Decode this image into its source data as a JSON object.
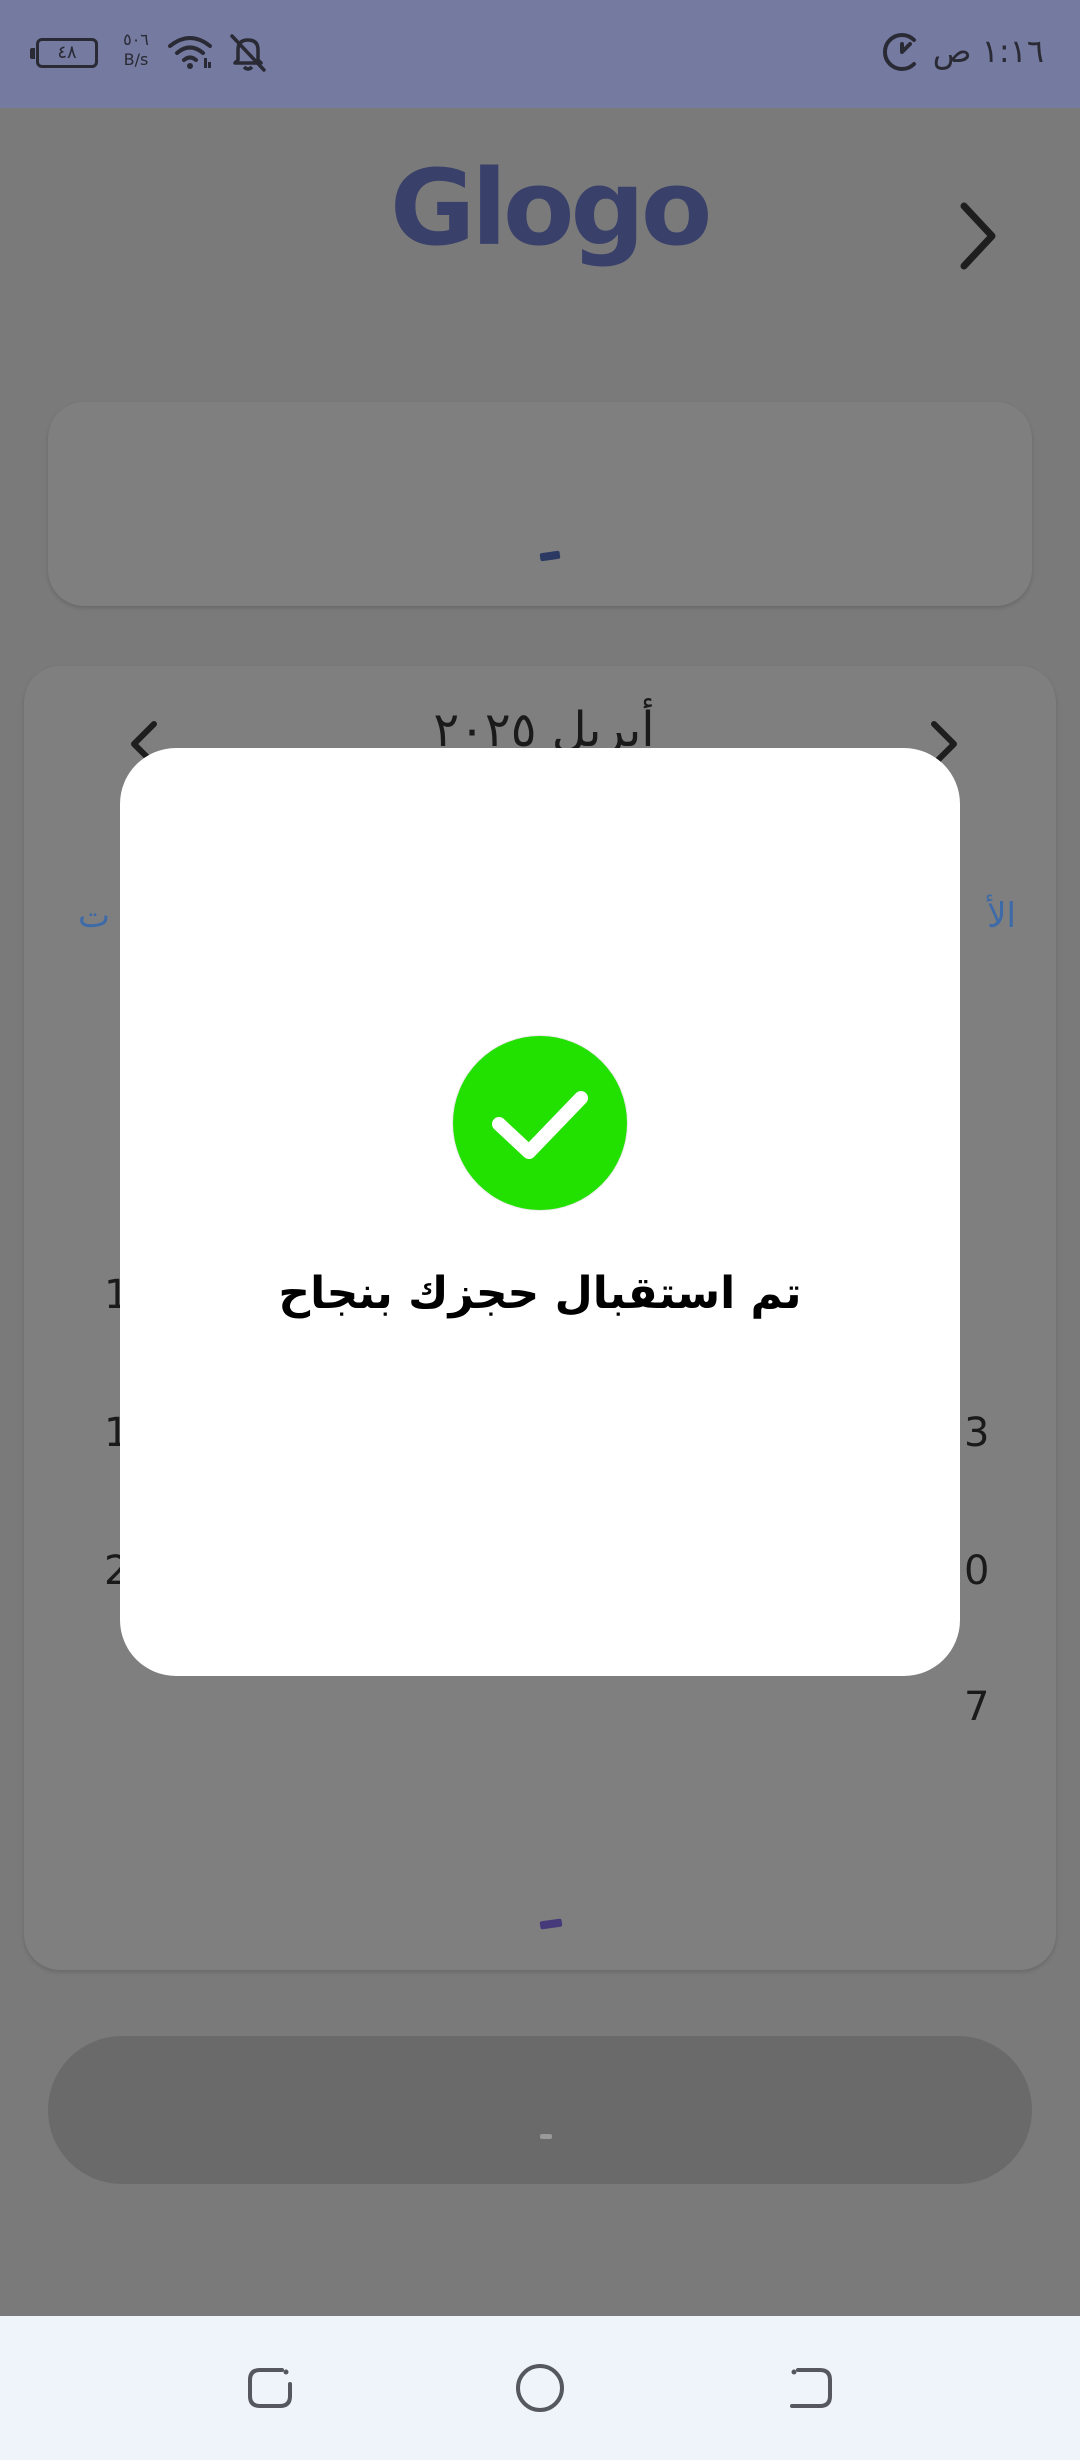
{
  "status_bar": {
    "time": "١:١٦ ص",
    "battery": "٤٨",
    "net_speed_value": "٥٠٦",
    "net_speed_unit": "B/s"
  },
  "header": {
    "logo_text": "Glogo"
  },
  "calendar": {
    "month_label": "أبريل ٢٠٢٥",
    "left_link": "ت",
    "right_link": "الأ",
    "visible_day_fragments_left": [
      "1",
      "1",
      "2"
    ],
    "visible_day_fragments_right": [
      "3",
      "0",
      "7"
    ]
  },
  "modal": {
    "message": "تم استقبال حجزك بنجاح",
    "accent_color": "#22e000"
  },
  "colors": {
    "status_bar": "#747aa0",
    "logo": "#39406a",
    "link": "#3d6aa8"
  }
}
